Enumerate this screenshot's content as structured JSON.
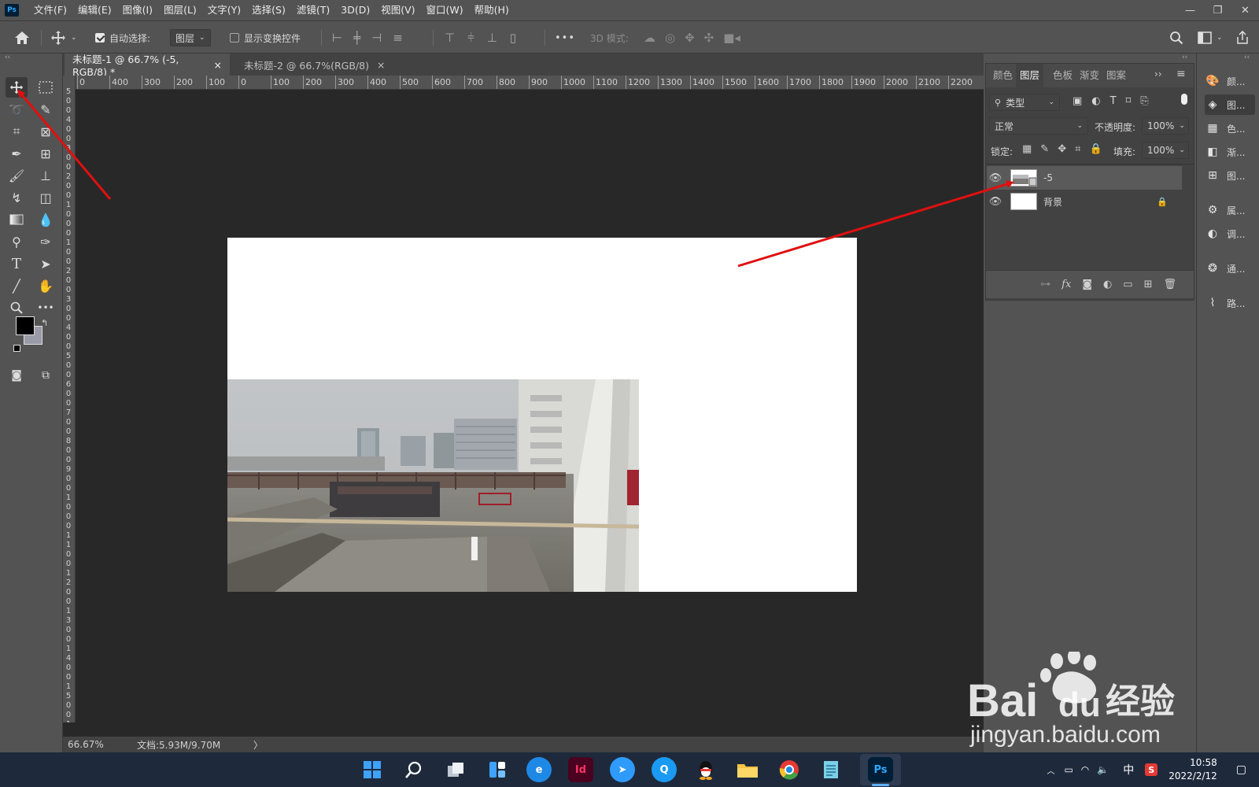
{
  "app": {
    "logo": "Ps",
    "accent": "#31a8ff"
  },
  "menu": [
    "文件(F)",
    "编辑(E)",
    "图像(I)",
    "图层(L)",
    "文字(Y)",
    "选择(S)",
    "滤镜(T)",
    "3D(D)",
    "视图(V)",
    "窗口(W)",
    "帮助(H)"
  ],
  "window_controls": {
    "minimize": "—",
    "restore": "❐",
    "close": "✕"
  },
  "options": {
    "auto_select_label": "自动选择:",
    "auto_select_checked": true,
    "auto_select_target": "图层",
    "show_transform_label": "显示变换控件",
    "show_transform_checked": false,
    "mode_3d_label": "3D 模式:",
    "more": "•••"
  },
  "tabs": [
    {
      "label": "未标题-1 @ 66.7% (-5, RGB/8) *",
      "close": "×"
    },
    {
      "label": "未标题-2 @ 66.7%(RGB/8)",
      "close": "×"
    }
  ],
  "ruler": {
    "h_labels": [
      "0",
      "400",
      "300",
      "200",
      "100",
      "0",
      "100",
      "200",
      "300",
      "400",
      "500",
      "600",
      "700",
      "800",
      "900",
      "1000",
      "1100",
      "1200",
      "1300",
      "1400",
      "1500",
      "1600",
      "1700",
      "1800",
      "1900",
      "2000",
      "2100",
      "2200"
    ],
    "v_labels": [
      "5",
      "0",
      "0",
      "4",
      "0",
      "0",
      "3",
      "0",
      "0",
      "2",
      "0",
      "0",
      "1",
      "0",
      "0",
      "0",
      "1",
      "0",
      "0",
      "2",
      "0",
      "0",
      "3",
      "0",
      "0",
      "4",
      "0",
      "0",
      "5",
      "0",
      "0",
      "6",
      "0",
      "0",
      "7",
      "0",
      "0",
      "8",
      "0",
      "0",
      "9",
      "0",
      "0",
      "1",
      "0",
      "0",
      "0",
      "1",
      "1",
      "0",
      "0",
      "1",
      "2",
      "0",
      "0",
      "1",
      "3",
      "0",
      "0",
      "1",
      "4",
      "0",
      "0",
      "1",
      "5",
      "0",
      "0",
      "1"
    ]
  },
  "status": {
    "zoom": "66.67%",
    "doc": "文档:5.93M/9.70M",
    "arrow": "〉"
  },
  "panel": {
    "tabs": [
      "颜色",
      "图层",
      "色板",
      "渐变",
      "图案"
    ],
    "active_tab": "图层",
    "filter_kind": "类型",
    "blend_mode": "正常",
    "opacity_label": "不透明度:",
    "opacity": "100%",
    "lock_label": "锁定:",
    "fill_label": "填充:",
    "fill": "100%",
    "layers": [
      {
        "name": "-5",
        "visible": true,
        "selected": true
      },
      {
        "name": "背景",
        "visible": true,
        "locked": true
      }
    ],
    "bottom_fx": "fx"
  },
  "dock": [
    {
      "icon": "palette-icon",
      "label": "颜..."
    },
    {
      "icon": "layers-icon",
      "label": "图..."
    },
    {
      "icon": "swatches-icon",
      "label": "色..."
    },
    {
      "icon": "gradient-icon",
      "label": "渐..."
    },
    {
      "icon": "pattern-icon",
      "label": "图..."
    },
    {
      "icon": "properties-icon",
      "label": "属..."
    },
    {
      "icon": "adjustments-icon",
      "label": "调..."
    },
    {
      "icon": "channels-icon",
      "label": "通..."
    },
    {
      "icon": "paths-icon",
      "label": "路..."
    }
  ],
  "taskbar": {
    "apps": [
      "Id",
      "Ps"
    ],
    "ime": "中",
    "ime2": "S",
    "time": "10:58",
    "date": "2022/2/12"
  },
  "watermark": {
    "brand": "Bai",
    "brand2": "经验",
    "url": "jingyan.baidu.com"
  }
}
